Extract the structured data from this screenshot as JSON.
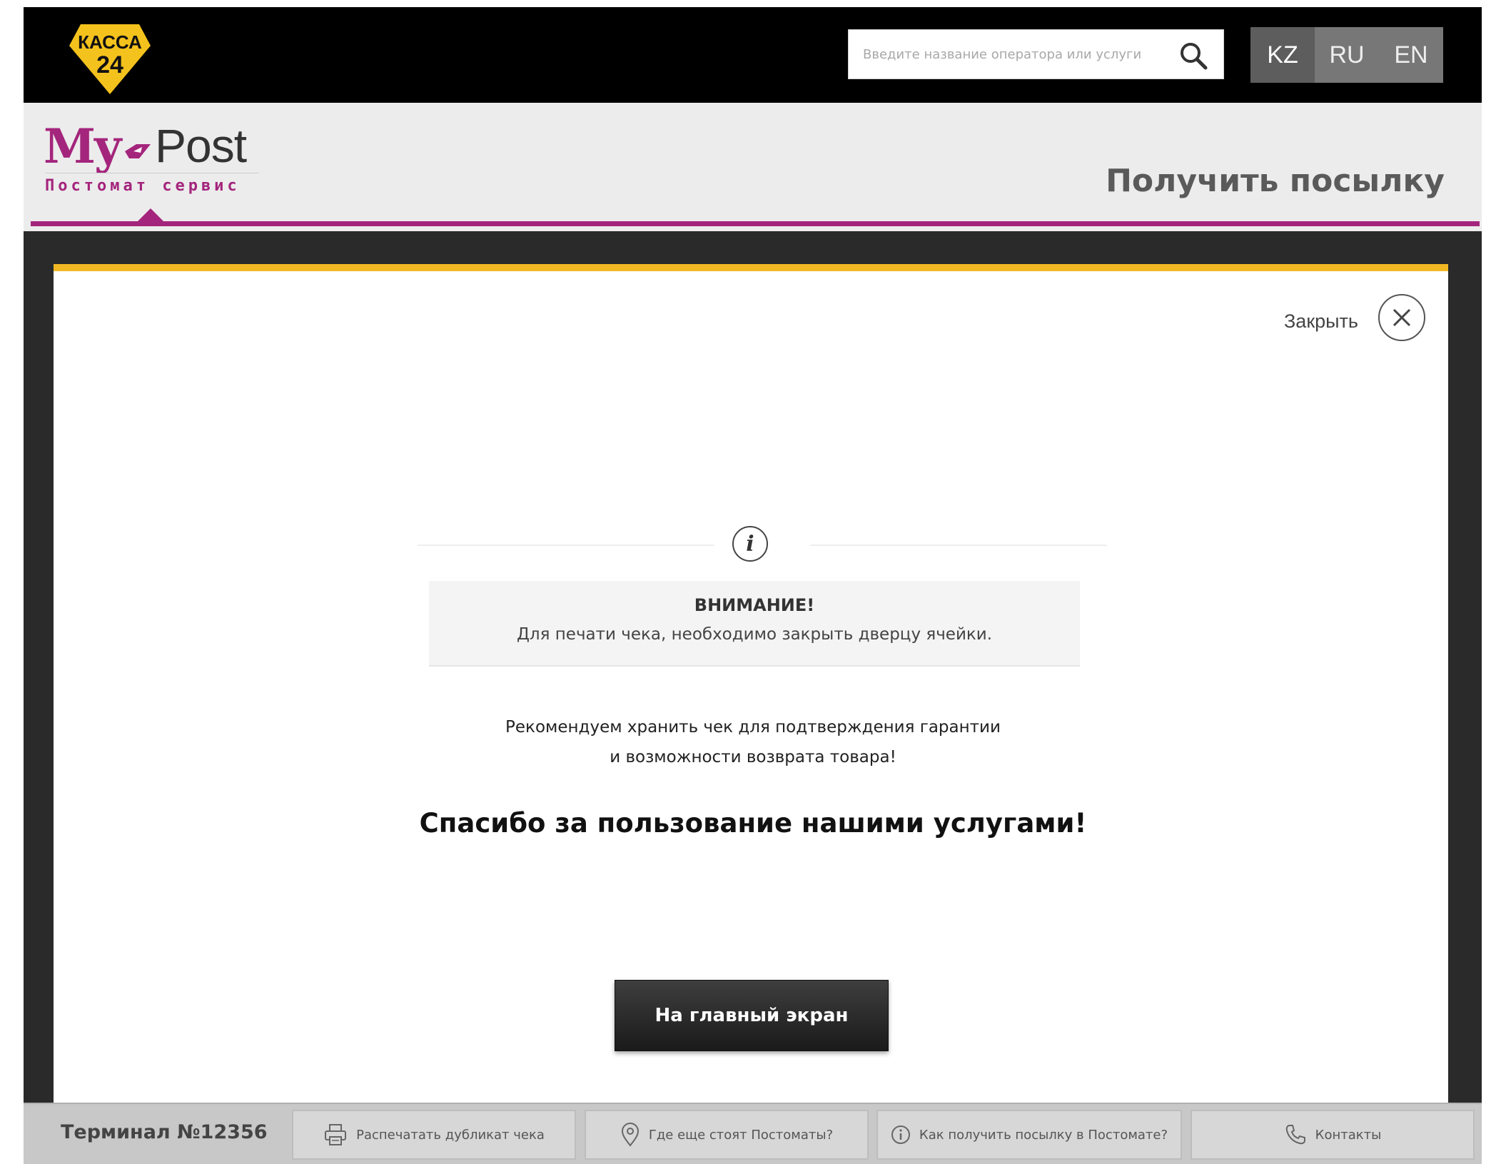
{
  "header": {
    "logo_text_line1": "КАССА",
    "logo_text_line2": "24",
    "search_placeholder": "Введите название оператора или услуги",
    "languages": [
      "KZ",
      "RU",
      "EN"
    ],
    "active_language": "KZ"
  },
  "brand": {
    "name_my": "My",
    "name_post": "Post",
    "subtitle": "Постомат сервис"
  },
  "page": {
    "title": "Получить посылку"
  },
  "modal": {
    "close_label": "Закрыть",
    "alert_title": "ВНИМАНИЕ!",
    "alert_text": "Для печати чека, необходимо закрыть дверцу ячейки.",
    "recommend_line1": "Рекомендуем хранить чек для подтверждения гарантии",
    "recommend_line2": "и возможности возврата товара!",
    "thanks": "Спасибо за пользование нашими услугами!",
    "home_button": "На главный экран"
  },
  "footer": {
    "terminal": "Терминал №12356",
    "buttons": [
      {
        "label": "Распечатать дубликат чека",
        "icon": "printer-icon"
      },
      {
        "label": "Где еще стоят Постоматы?",
        "icon": "location-pin-icon"
      },
      {
        "label": "Как получить посылку в Постомате?",
        "icon": "info-icon"
      },
      {
        "label": "Контакты",
        "icon": "phone-icon"
      }
    ]
  },
  "colors": {
    "brand_purple": "#a4257c",
    "accent_yellow": "#f2b824",
    "topbar": "#000000"
  }
}
